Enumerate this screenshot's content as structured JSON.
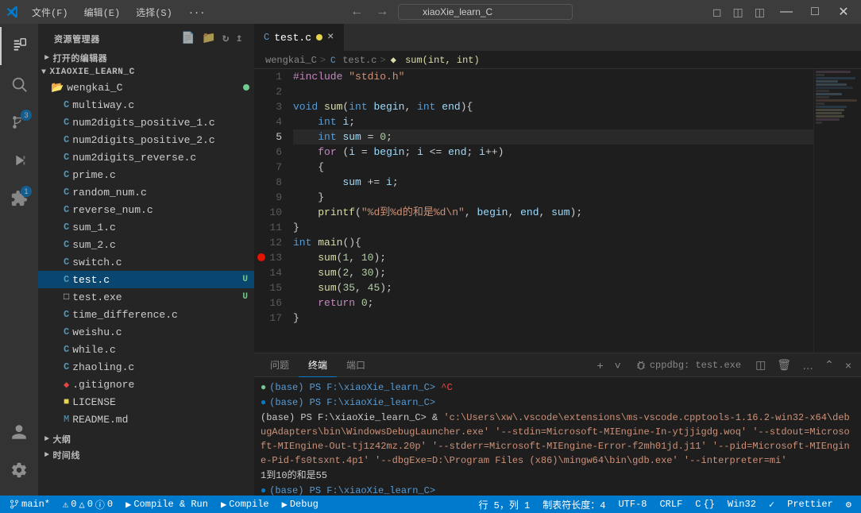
{
  "titleBar": {
    "appName": "xiaoXie_learn_C",
    "menus": [
      "文件(F)",
      "编辑(E)",
      "选择(S)",
      "..."
    ],
    "searchPlaceholder": "xiaoXie_learn_C",
    "windowButtons": [
      "─",
      "□",
      "✕"
    ]
  },
  "activityBar": {
    "items": [
      {
        "name": "explorer",
        "icon": "⊞",
        "active": true
      },
      {
        "name": "search",
        "icon": "🔍"
      },
      {
        "name": "source-control",
        "icon": "⑃",
        "badge": "3"
      },
      {
        "name": "run",
        "icon": "▷"
      },
      {
        "name": "extensions",
        "icon": "⊡",
        "badge": "1"
      }
    ],
    "bottomItems": [
      {
        "name": "account",
        "icon": "👤"
      },
      {
        "name": "settings",
        "icon": "⚙"
      }
    ]
  },
  "sidebar": {
    "title": "资源管理器",
    "openEditors": "打开的编辑器",
    "projectName": "XIAOXIE_LEARN_C",
    "folders": [
      {
        "name": "wengkai_C",
        "dot": "green",
        "files": [
          {
            "name": "multiway.c",
            "type": "c"
          },
          {
            "name": "num2digits_positive_1.c",
            "type": "c"
          },
          {
            "name": "num2digits_positive_2.c",
            "type": "c"
          },
          {
            "name": "num2digits_reverse.c",
            "type": "c"
          },
          {
            "name": "prime.c",
            "type": "c"
          },
          {
            "name": "random_num.c",
            "type": "c"
          },
          {
            "name": "reverse_num.c",
            "type": "c"
          },
          {
            "name": "sum_1.c",
            "type": "c"
          },
          {
            "name": "sum_2.c",
            "type": "c"
          },
          {
            "name": "switch.c",
            "type": "c"
          },
          {
            "name": "test.c",
            "type": "c",
            "selected": true,
            "modified": "U"
          },
          {
            "name": "test.exe",
            "type": "exe",
            "modified": "U"
          },
          {
            "name": "time_difference.c",
            "type": "c"
          },
          {
            "name": "weishu.c",
            "type": "c"
          },
          {
            "name": "while.c",
            "type": "c"
          },
          {
            "name": "zhaoling.c",
            "type": "c"
          },
          {
            "name": ".gitignore",
            "type": "git"
          },
          {
            "name": "LICENSE",
            "type": "license"
          },
          {
            "name": "README.md",
            "type": "md"
          }
        ]
      }
    ],
    "sections": [
      "大纲",
      "时间线"
    ]
  },
  "tabs": [
    {
      "label": "test.c",
      "active": true,
      "modified": false,
      "dot": true
    }
  ],
  "breadcrumb": {
    "parts": [
      "wengkai_C",
      ">",
      "test.c",
      ">",
      "sum(int, int)"
    ]
  },
  "code": {
    "lines": [
      {
        "num": 1,
        "content": "#include \"stdio.h\""
      },
      {
        "num": 2,
        "content": ""
      },
      {
        "num": 3,
        "content": "void sum(int begin, int end){"
      },
      {
        "num": 4,
        "content": "    int i;"
      },
      {
        "num": 5,
        "content": "    int sum = 0;"
      },
      {
        "num": 6,
        "content": "    for (i = begin; i <= end; i++)"
      },
      {
        "num": 7,
        "content": "    {"
      },
      {
        "num": 8,
        "content": "        sum += i;"
      },
      {
        "num": 9,
        "content": "    }"
      },
      {
        "num": 10,
        "content": "    printf(\"%d到%d的和是%d\\n\", begin, end, sum);"
      },
      {
        "num": 11,
        "content": "}"
      },
      {
        "num": 12,
        "content": "int main(){"
      },
      {
        "num": 13,
        "content": "    sum(1, 10);",
        "breakpoint": true
      },
      {
        "num": 14,
        "content": "    sum(2, 30);"
      },
      {
        "num": 15,
        "content": "    sum(35, 45);"
      },
      {
        "num": 16,
        "content": "    return 0;"
      },
      {
        "num": 17,
        "content": "}"
      }
    ]
  },
  "panel": {
    "tabs": [
      "问题",
      "终端",
      "端口"
    ],
    "activeTab": "终端",
    "terminalTitle": "cppdbg: test.exe",
    "terminalLines": [
      {
        "type": "prompt",
        "text": "(base) PS F:\\xiaoXie_learn_C> ^C"
      },
      {
        "type": "prompt2",
        "text": "(base) PS F:\\xiaoXie_learn_C>"
      },
      {
        "type": "long",
        "text": "(base) PS F:\\xiaoXie_learn_C> & 'c:\\Users\\xw\\.vscode\\extensions\\ms-vscode.cpptools-1.16.2-win32-x64\\debugAdapters\\bin\\WindowsDebugLauncher.exe' '--stdin=Microsoft-MIEngine-In-ytjjigdg.woq' '--stdout=Microsoft-MIEngine-Out-tj1z42mz.20p' '--stderr=Microsoft-MIEngine-Error-f2mh01jd.j11' '--pid=Microsoft-MIEngine-Pid-fs0tsxnt.4p1' '--dbgExe=D:\\Program Files (x86)\\mingw64\\bin\\gdb.exe' '--interpreter=mi'"
      },
      {
        "type": "result",
        "text": "1到10的和是55"
      },
      {
        "type": "prompt2",
        "text": "(base) PS F:\\xiaoXie_learn_C>"
      }
    ]
  },
  "statusBar": {
    "branch": "main*",
    "errors": "0",
    "warnings": "0",
    "info": "0",
    "position": "行 5，列 1",
    "spaces": "制表符长度：4",
    "encoding": "UTF-8",
    "lineEnding": "CRLF",
    "language": "C",
    "arch": "Win32",
    "formatter": "Prettier",
    "compileRun": "Compile & Run",
    "compile": "Compile",
    "debug": "Debug"
  }
}
